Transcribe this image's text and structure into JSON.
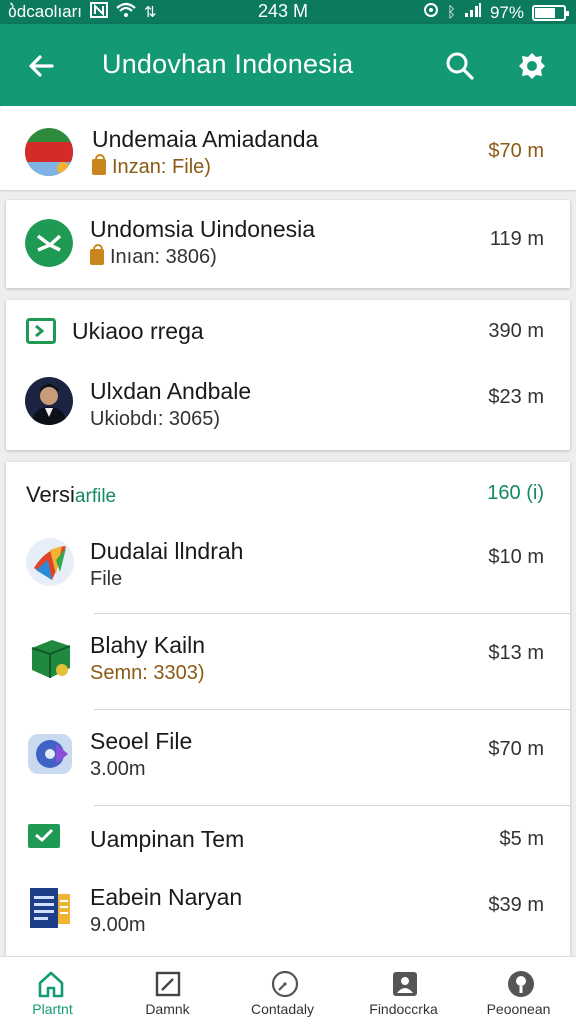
{
  "status_bar": {
    "carrier": "ბdcaolıarı",
    "time": "243 M",
    "signal_percent": "97%",
    "battery_level": 0.7,
    "icons": [
      "nfc-icon",
      "wifi-icon",
      "data-icon",
      "bluetooth-icon",
      "location-icon",
      "signal-icon",
      "battery-icon"
    ]
  },
  "app_bar": {
    "title": "Undovhan Indonesia",
    "back_icon": "arrow-back-icon",
    "search_icon": "search-icon",
    "action_icon": "badge-icon"
  },
  "colors": {
    "status_bar": "#0c7a5f",
    "app_bar": "#139a75",
    "accent_gold": "#8a5a15",
    "accent_green": "#158a5c",
    "background": "#eeeeee"
  },
  "cards": [
    {
      "rows": [
        {
          "title": "Undemaia Amiadanda",
          "subtitle": "Inzan: File)",
          "value": "$70 m",
          "icon": "flag-avatar-icon"
        }
      ]
    },
    {
      "rows": [
        {
          "title": "Undomsia Uindonesia",
          "subtitle": "Inıan: 3806)",
          "value": "119 m",
          "icon": "green-circle-arrow-icon"
        }
      ]
    },
    {
      "rows": [
        {
          "title": "Ukiaoo rrega",
          "value": "390 m",
          "icon": "green-square-arrow-icon"
        },
        {
          "title": "Ulxdan Andbale",
          "subtitle": "Ukiobdı: 3065)",
          "value": "$23 m",
          "icon": "person-avatar-icon"
        }
      ]
    },
    {
      "header": {
        "title_plain": "Versi",
        "title_accent": "arfile",
        "value": "160 (i)"
      },
      "rows": [
        {
          "title": "Dudalai llndrah",
          "subtitle": "File",
          "value": "$10 m",
          "icon": "colorful-app-icon"
        },
        {
          "title": "Blahy Kailn",
          "subtitle": "Semn: 3303)",
          "value": "$13 m",
          "icon": "green-box-icon"
        },
        {
          "title": "Seoel File",
          "subtitle": "3.00m",
          "value": "$70 m",
          "icon": "blue-disc-icon"
        },
        {
          "title": "Uampinan Tem",
          "value": "$5 m",
          "icon": "green-check-icon"
        },
        {
          "title": "Eabein Naryan",
          "subtitle": "9.00m",
          "value": "$39 m",
          "icon": "document-icon"
        }
      ]
    }
  ],
  "bottom_nav": [
    {
      "label": "Plartnt",
      "icon": "home-icon",
      "active": true
    },
    {
      "label": "Damnk",
      "icon": "edit-square-icon",
      "active": false
    },
    {
      "label": "Contadaly",
      "icon": "clock-icon",
      "active": false
    },
    {
      "label": "Findoccrka",
      "icon": "contact-card-icon",
      "active": false
    },
    {
      "label": "Peoonean",
      "icon": "info-circle-icon",
      "active": false
    }
  ]
}
